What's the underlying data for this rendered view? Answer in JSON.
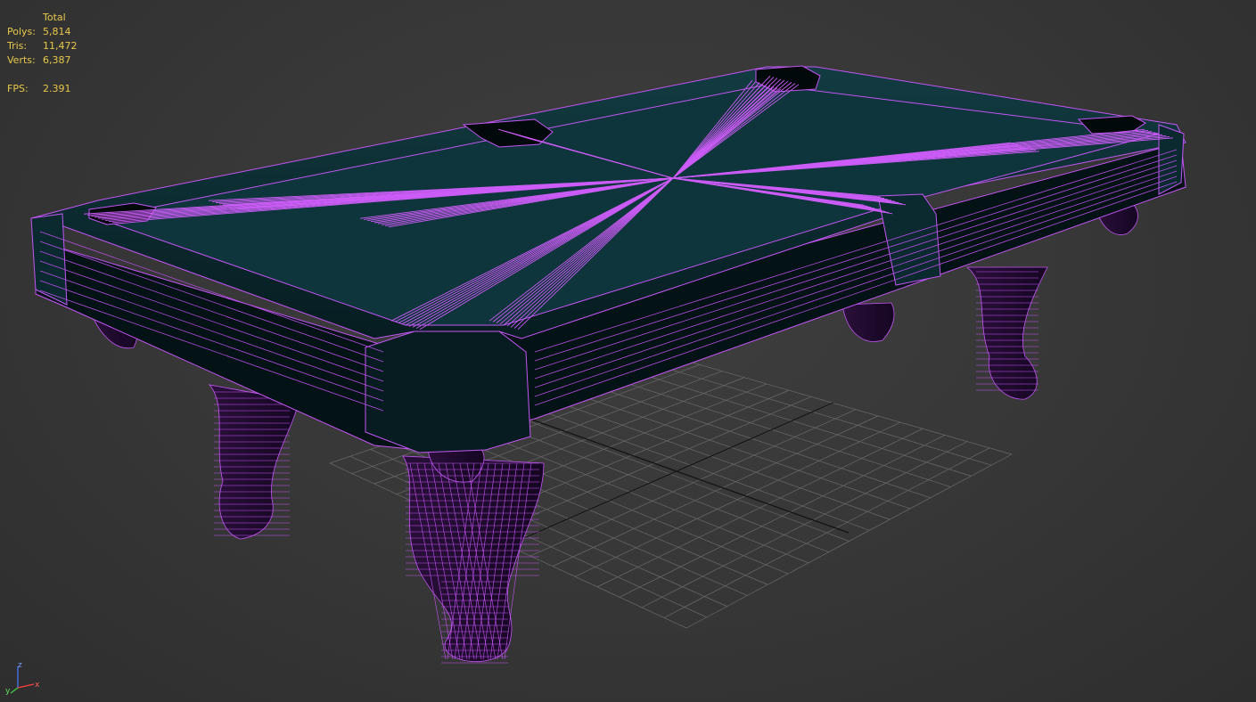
{
  "stats": {
    "header": "Total",
    "polys_label": "Polys:",
    "polys_value": "5,814",
    "tris_label": "Tris:",
    "tris_value": "11,472",
    "verts_label": "Verts:",
    "verts_value": "6,387",
    "fps_label": "FPS:",
    "fps_value": "2.391"
  },
  "gizmo": {
    "z_label": "z",
    "x_label": "x",
    "y_label": "y"
  },
  "colors": {
    "background": "#3a3a3a",
    "wire": "#cc55ff",
    "felt": "#0f3a40",
    "stats_text": "#e8c94a",
    "grid": "#6e6e6e"
  },
  "icons": [
    "axis-gizmo-icon"
  ]
}
